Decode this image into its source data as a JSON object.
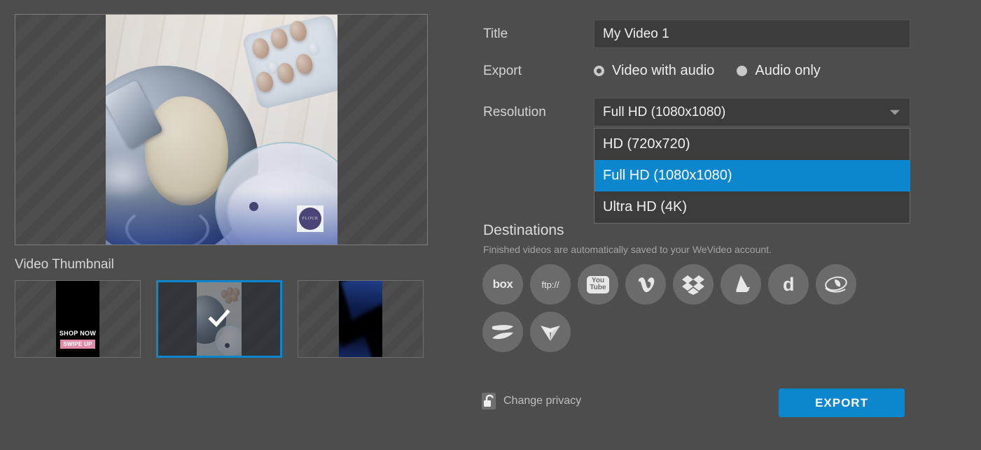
{
  "theme": {
    "background": "#4d4d4d",
    "accent_blue": "#0c86cc",
    "input_bg": "#3c3c3c",
    "pink_badge": "#e08aa8"
  },
  "preview": {
    "label": "video-preview"
  },
  "thumbnails": {
    "label": "Video Thumbnail",
    "items": [
      {
        "index": 1,
        "selected": false,
        "overlay_heading": "SHOP NOW",
        "overlay_badge": "SWIPE UP"
      },
      {
        "index": 2,
        "selected": true,
        "overlay_heading": "",
        "overlay_badge": ""
      },
      {
        "index": 3,
        "selected": false,
        "overlay_heading": "",
        "overlay_badge": ""
      }
    ]
  },
  "form": {
    "title": {
      "label": "Title",
      "value": "My Video 1",
      "placeholder": "Title"
    },
    "export": {
      "label": "Export",
      "options": [
        {
          "label": "Video with audio",
          "selected": true
        },
        {
          "label": "Audio only",
          "selected": false
        }
      ]
    },
    "resolution": {
      "label": "Resolution",
      "value": "Full HD (1080x1080)",
      "expanded": true,
      "options": [
        {
          "label": "HD (720x720)",
          "highlighted": false
        },
        {
          "label": "Full HD (1080x1080)",
          "highlighted": true
        },
        {
          "label": "Ultra HD (4K)",
          "highlighted": false
        }
      ]
    }
  },
  "destinations": {
    "title": "Destinations",
    "note": "Finished videos are automatically saved to your WeVideo account.",
    "items": [
      {
        "icon": "box-icon",
        "text": "box",
        "style": "wordmark"
      },
      {
        "icon": "ftp-icon",
        "text": "ftp://",
        "style": "wordmark-small"
      },
      {
        "icon": "youtube-icon",
        "text_top": "You",
        "text_bottom": "Tube",
        "style": "youtube"
      },
      {
        "icon": "vimeo-icon",
        "text": "v",
        "style": "glyph"
      },
      {
        "icon": "dropbox-icon",
        "text": "",
        "style": "shape"
      },
      {
        "icon": "google-drive-icon",
        "text": "",
        "style": "shape"
      },
      {
        "icon": "dailymotion-icon",
        "text": "d",
        "style": "glyph"
      },
      {
        "icon": "brightcove-icon",
        "text": "",
        "style": "shape"
      },
      {
        "icon": "swoosh-icon",
        "text": "",
        "style": "shape"
      },
      {
        "icon": "wing-icon",
        "text": "",
        "style": "shape"
      }
    ]
  },
  "footer": {
    "privacy_label": "Change privacy",
    "privacy_icon": "unlock-icon",
    "export_label": "EXPORT"
  }
}
